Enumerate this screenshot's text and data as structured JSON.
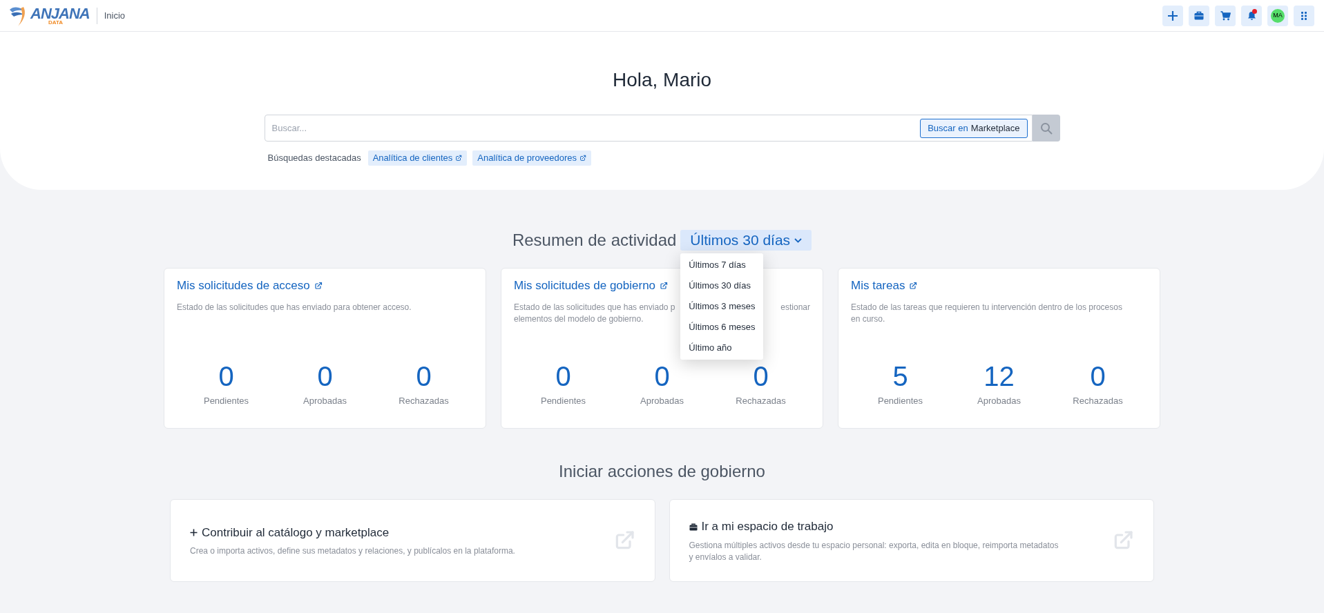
{
  "header": {
    "logo_text": "ANJANA",
    "logo_subtext": "DATA",
    "breadcrumb": "Inicio",
    "actions": [
      {
        "kind": "add"
      },
      {
        "kind": "briefcase"
      },
      {
        "kind": "cart"
      },
      {
        "kind": "bell",
        "notification": true
      },
      {
        "kind": "avatar",
        "label": "MA"
      },
      {
        "kind": "apps"
      }
    ]
  },
  "greeting": "Hola, Mario",
  "search": {
    "placeholder": "Buscar...",
    "scope_prefix": "Buscar en",
    "scope_name": "Marketplace"
  },
  "featured": {
    "label": "Búsquedas destacadas",
    "items": [
      "Analítica de clientes",
      "Analítica de proveedores"
    ]
  },
  "activity": {
    "title": "Resumen de actividad",
    "period": "Últimos 30 días",
    "menu_open": true,
    "menu": [
      "Últimos 7 días",
      "Últimos 30 días",
      "Últimos 3 meses",
      "Últimos 6 meses",
      "Último año"
    ]
  },
  "cards": [
    {
      "title": "Mis solicitudes de acceso",
      "description": [
        [
          "Estado de las solicitudes que has enviado para obtener acceso."
        ]
      ],
      "stats": [
        {
          "value": "0",
          "label": "Pendientes"
        },
        {
          "value": "0",
          "label": "Aprobadas"
        },
        {
          "value": "0",
          "label": "Rechazadas"
        }
      ]
    },
    {
      "title": "Mis solicitudes de gobierno",
      "description": [
        [
          "Estado de las solicitudes que has enviado p",
          "estionar"
        ],
        [
          "elementos del modelo de gobierno."
        ]
      ],
      "stats": [
        {
          "value": "0",
          "label": "Pendientes"
        },
        {
          "value": "0",
          "label": "Aprobadas"
        },
        {
          "value": "0",
          "label": "Rechazadas"
        }
      ]
    },
    {
      "title": "Mis tareas",
      "description": [
        [
          "Estado de las tareas que requieren tu intervención dentro de los procesos"
        ],
        [
          "en curso."
        ]
      ],
      "stats": [
        {
          "value": "5",
          "label": "Pendientes"
        },
        {
          "value": "12",
          "label": "Aprobadas"
        },
        {
          "value": "0",
          "label": "Rechazadas"
        }
      ]
    }
  ],
  "governance": {
    "title": "Iniciar acciones de gobierno",
    "actions": [
      {
        "kind": "add",
        "title": "Contribuir al catálogo y marketplace",
        "description": "Crea o importa activos, define sus metadatos y relaciones, y publícalos en la plataforma."
      },
      {
        "kind": "workspace",
        "title": "Ir a mi espacio de trabajo",
        "description": "Gestiona múltiples activos desde tu espacio personal: exporta, edita en bloque, reimporta metadatos y envíalos a validar."
      }
    ]
  }
}
